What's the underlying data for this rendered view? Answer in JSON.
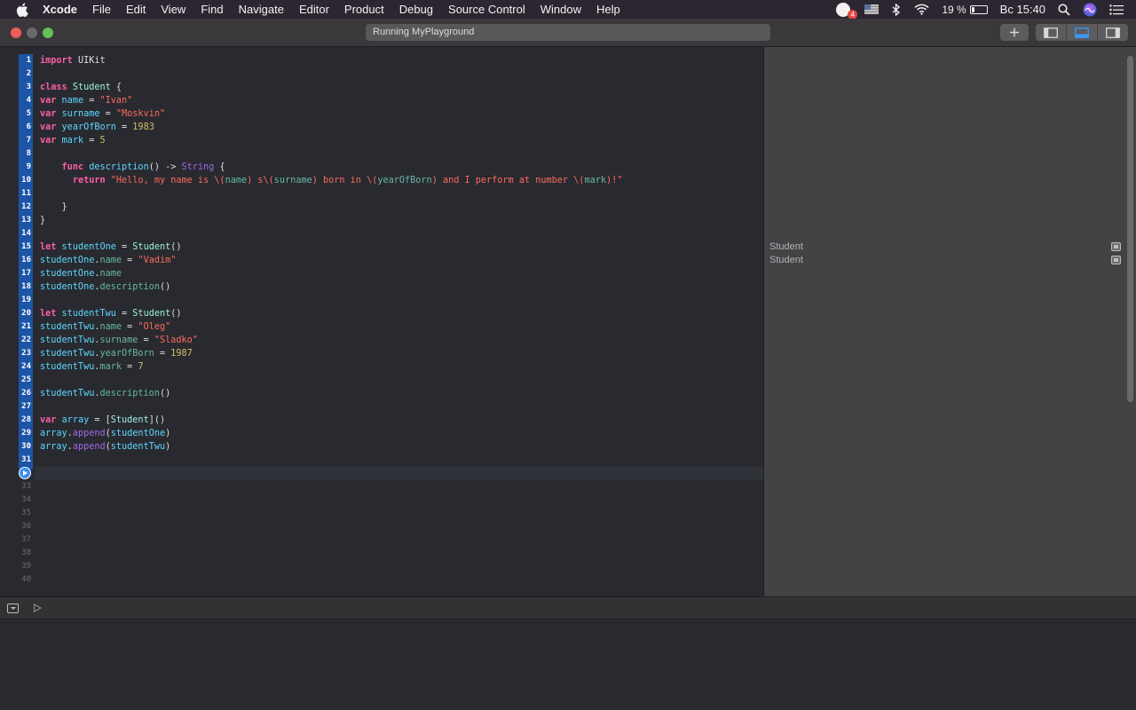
{
  "menubar": {
    "app_name": "Xcode",
    "items": [
      "File",
      "Edit",
      "View",
      "Find",
      "Navigate",
      "Editor",
      "Product",
      "Debug",
      "Source Control",
      "Window",
      "Help"
    ],
    "notification_count": "4",
    "battery_percent": "19 %",
    "battery_level": 0.19,
    "clock": "Вс 15:40"
  },
  "toolbar": {
    "activity_text": "Running MyPlayground"
  },
  "editor": {
    "line_numbers": [
      "1",
      "2",
      "3",
      "4",
      "5",
      "6",
      "7",
      "8",
      "9",
      "10",
      "11",
      "12",
      "13",
      "14",
      "15",
      "16",
      "17",
      "18",
      "19",
      "20",
      "21",
      "22",
      "23",
      "24",
      "25",
      "26",
      "27",
      "28",
      "29",
      "30",
      "31",
      "32",
      "33",
      "34",
      "35",
      "36",
      "37",
      "38",
      "39",
      "40"
    ],
    "executed_through_line": 31,
    "current_line": 32,
    "code": [
      "import UIKit",
      "",
      "class Student {",
      "var name = \"Ivan\"",
      "var surname = \"Moskvin\"",
      "var yearOfBorn = 1983",
      "var mark = 5",
      "",
      "    func description() -> String {",
      "      return \"Hello, my name is \\(name) s\\(surname) born in \\(yearOfBorn) and I perform at number \\(mark)!\"",
      "",
      "    }",
      "}",
      "",
      "let studentOne = Student()",
      "studentOne.name = \"Vadim\"",
      "studentOne.name",
      "studentOne.description()",
      "",
      "let studentTwu = Student()",
      "studentTwu.name = \"Oleg\"",
      "studentTwu.surname = \"Sladko\"",
      "studentTwu.yearOfBorn = 1987",
      "studentTwu.mark = 7",
      "",
      "studentTwu.description()",
      "",
      "var array = [Student]()",
      "array.append(studentOne)",
      "array.append(studentTwu)",
      ""
    ]
  },
  "results": {
    "rows": [
      {
        "line": 15,
        "text": "Student"
      },
      {
        "line": 16,
        "text": "Student"
      }
    ]
  },
  "colors": {
    "keyword": "#fc5fa3",
    "string": "#fc6a5d",
    "number": "#d0bf69",
    "type": "#5dd8ff",
    "property": "#67b7a4",
    "run_band": "#1c54a6"
  }
}
